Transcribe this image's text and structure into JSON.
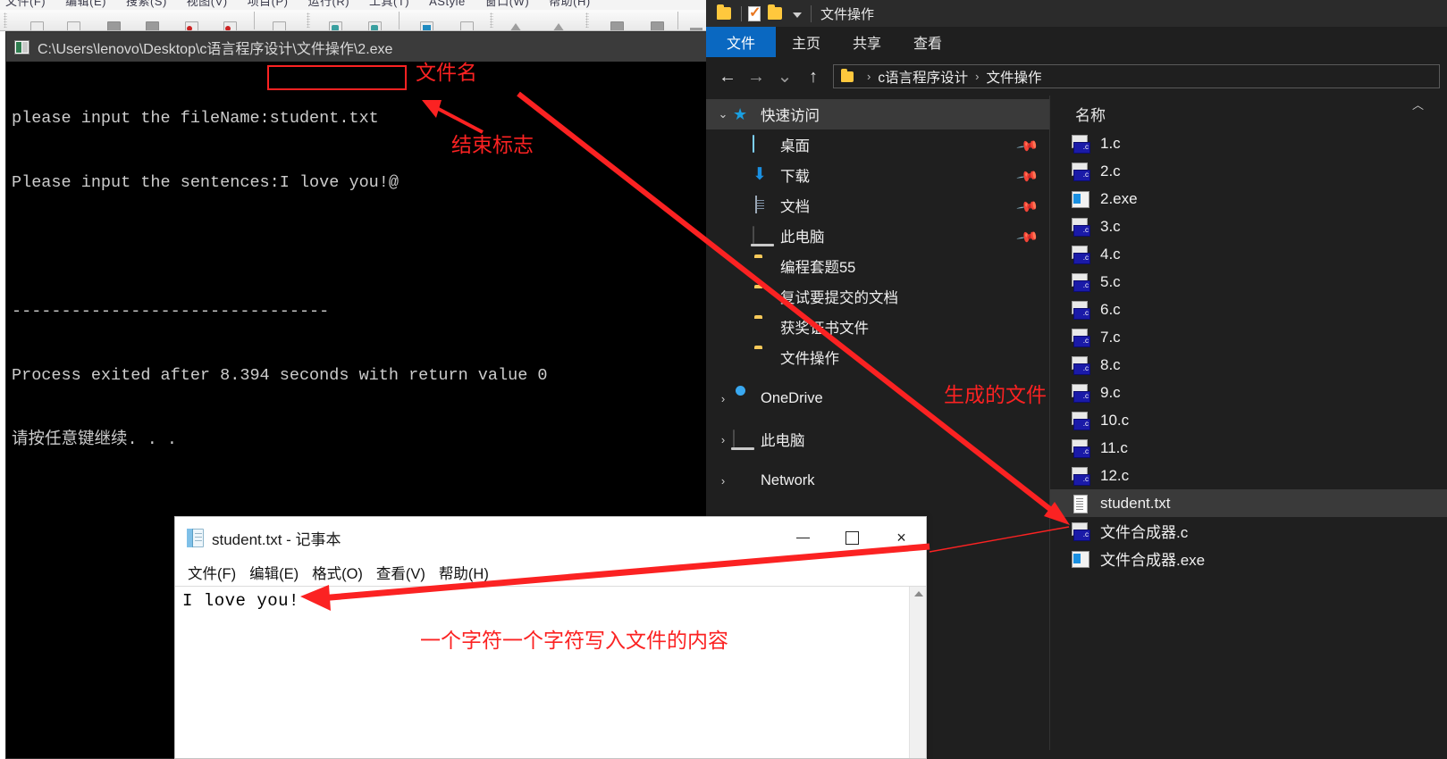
{
  "ide": {
    "menu_items": [
      "文件(F)",
      "编辑(E)",
      "搜索(S)",
      "视图(V)",
      "项目(P)",
      "运行(R)",
      "工具(T)",
      "AStyle",
      "窗口(W)",
      "帮助(H)"
    ]
  },
  "console": {
    "title": "C:\\Users\\lenovo\\Desktop\\c语言程序设计\\文件操作\\2.exe",
    "title_icon": "console-app-icon",
    "lines": [
      "please input the fileName:student.txt",
      "Please input the sentences:I love you!@",
      "",
      "--------------------------------",
      "Process exited after 8.394 seconds with return value 0",
      "请按任意键继续. . ."
    ]
  },
  "explorer": {
    "window_title": "文件操作",
    "quick_access_toolbar": [
      "folder-icon",
      "properties-icon",
      "new-folder-icon",
      "customize-caret-icon"
    ],
    "ribbon_tabs": [
      {
        "label": "文件",
        "active": true
      },
      {
        "label": "主页",
        "active": false
      },
      {
        "label": "共享",
        "active": false
      },
      {
        "label": "查看",
        "active": false
      }
    ],
    "nav_buttons": {
      "back": "←",
      "forward": "→",
      "recent": "⌄",
      "up": "↑"
    },
    "breadcrumb": [
      "c语言程序设计",
      "文件操作"
    ],
    "nav_pane": [
      {
        "label": "快速访问",
        "icon": "star-icon",
        "chevron": "⌄",
        "selected": true,
        "indent": 0,
        "pinned": false
      },
      {
        "label": "桌面",
        "icon": "desktop-icon",
        "indent": 1,
        "pinned": true
      },
      {
        "label": "下载",
        "icon": "download-icon",
        "indent": 1,
        "pinned": true
      },
      {
        "label": "文档",
        "icon": "documents-icon",
        "indent": 1,
        "pinned": true
      },
      {
        "label": "此电脑",
        "icon": "this-pc-icon",
        "indent": 1,
        "pinned": true
      },
      {
        "label": "编程套题55",
        "icon": "folder-icon",
        "indent": 1,
        "pinned": false
      },
      {
        "label": "复试要提交的文档",
        "icon": "folder-icon",
        "indent": 1,
        "pinned": false
      },
      {
        "label": "获奖证书文件",
        "icon": "folder-icon",
        "indent": 1,
        "pinned": false
      },
      {
        "label": "文件操作",
        "icon": "folder-icon",
        "indent": 1,
        "pinned": false
      },
      {
        "label": "OneDrive",
        "icon": "onedrive-icon",
        "chevron": "›",
        "indent": 0,
        "pinned": false
      },
      {
        "label": "此电脑",
        "icon": "this-pc-icon",
        "chevron": "›",
        "indent": 0,
        "pinned": false
      },
      {
        "label": "Network",
        "icon": "network-icon",
        "chevron": "›",
        "indent": 0,
        "pinned": false
      }
    ],
    "column_header": "名称",
    "files": [
      {
        "name": "1.c",
        "icon": "c-source-icon",
        "selected": false
      },
      {
        "name": "2.c",
        "icon": "c-source-icon",
        "selected": false
      },
      {
        "name": "2.exe",
        "icon": "exe-icon",
        "selected": false
      },
      {
        "name": "3.c",
        "icon": "c-source-icon",
        "selected": false
      },
      {
        "name": "4.c",
        "icon": "c-source-icon",
        "selected": false
      },
      {
        "name": "5.c",
        "icon": "c-source-icon",
        "selected": false
      },
      {
        "name": "6.c",
        "icon": "c-source-icon",
        "selected": false
      },
      {
        "name": "7.c",
        "icon": "c-source-icon",
        "selected": false
      },
      {
        "name": "8.c",
        "icon": "c-source-icon",
        "selected": false
      },
      {
        "name": "9.c",
        "icon": "c-source-icon",
        "selected": false
      },
      {
        "name": "10.c",
        "icon": "c-source-icon",
        "selected": false
      },
      {
        "name": "11.c",
        "icon": "c-source-icon",
        "selected": false
      },
      {
        "name": "12.c",
        "icon": "c-source-icon",
        "selected": false
      },
      {
        "name": "student.txt",
        "icon": "text-file-icon",
        "selected": true
      },
      {
        "name": "文件合成器.c",
        "icon": "c-source-icon",
        "selected": false
      },
      {
        "name": "文件合成器.exe",
        "icon": "exe-icon",
        "selected": false
      }
    ]
  },
  "notepad": {
    "title": "student.txt - 记事本",
    "menu": [
      "文件(F)",
      "编辑(E)",
      "格式(O)",
      "查看(V)",
      "帮助(H)"
    ],
    "content": "I love you!",
    "buttons": {
      "minimize": "minimize-button",
      "maximize": "maximize-button",
      "close": "×"
    }
  },
  "annotations": {
    "accent_color": "#fb2222",
    "filename_label": "文件名",
    "end_marker_label": "结束标志",
    "generated_file_label": "生成的文件",
    "file_content_label": "一个字符一个字符写入文件的内容"
  }
}
